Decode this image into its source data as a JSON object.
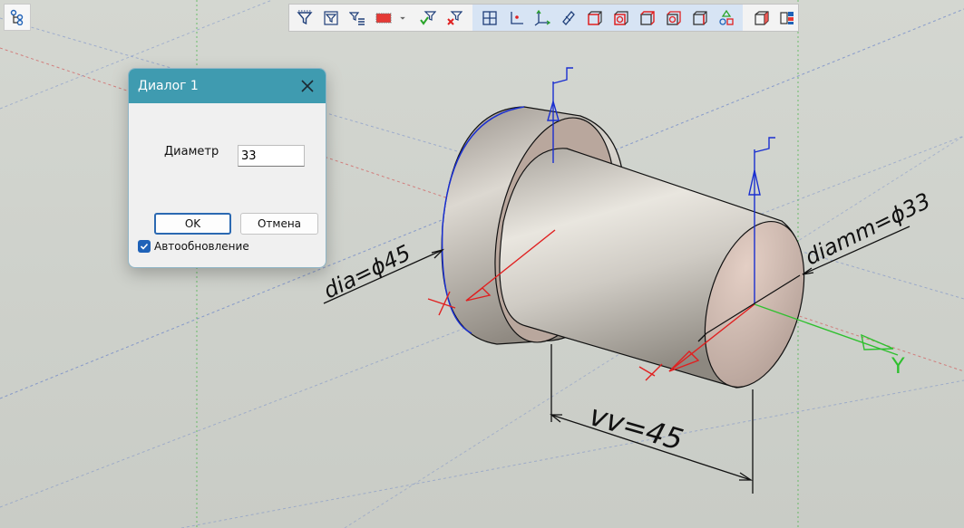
{
  "toolbar": {
    "buttons": [
      {
        "icon": "filter-icon"
      },
      {
        "icon": "filter-box-icon"
      },
      {
        "icon": "filter-list-icon"
      },
      {
        "icon": "color-fill-icon"
      },
      {
        "icon": "dropdown-arrow-icon"
      },
      {
        "icon": "filter-apply-icon"
      },
      {
        "icon": "filter-clear-icon"
      },
      {
        "icon": "grid-view-icon"
      },
      {
        "icon": "axis-point-icon"
      },
      {
        "icon": "axis-arrows-icon"
      },
      {
        "icon": "plane-icon"
      },
      {
        "icon": "solid-front-icon"
      },
      {
        "icon": "solid-top-icon"
      },
      {
        "icon": "solid-side-icon"
      },
      {
        "icon": "solid-iso-icon"
      },
      {
        "icon": "solid-shade-icon"
      },
      {
        "icon": "shapes-icon"
      },
      {
        "icon": "cube-view-icon"
      },
      {
        "icon": "layers-icon"
      }
    ]
  },
  "dialog": {
    "title": "Диалог 1",
    "diameter_label": "Диаметр",
    "diameter_value": "33",
    "ok_label": "OK",
    "cancel_label": "Отмена",
    "auto_update_label": "Автообновление",
    "auto_update_checked": true
  },
  "viewport": {
    "dimensions": {
      "dia": "dia=ϕ45",
      "diamm": "diamm=ϕ33",
      "length": "vv=45"
    },
    "axis_label": "Y",
    "colors": {
      "background": "#cfd2cc",
      "dialog_title": "#3f9bb0",
      "axis_y": "#2fc02f",
      "axis_x": "#e02020",
      "axis_z": "#1a2fd0"
    }
  }
}
